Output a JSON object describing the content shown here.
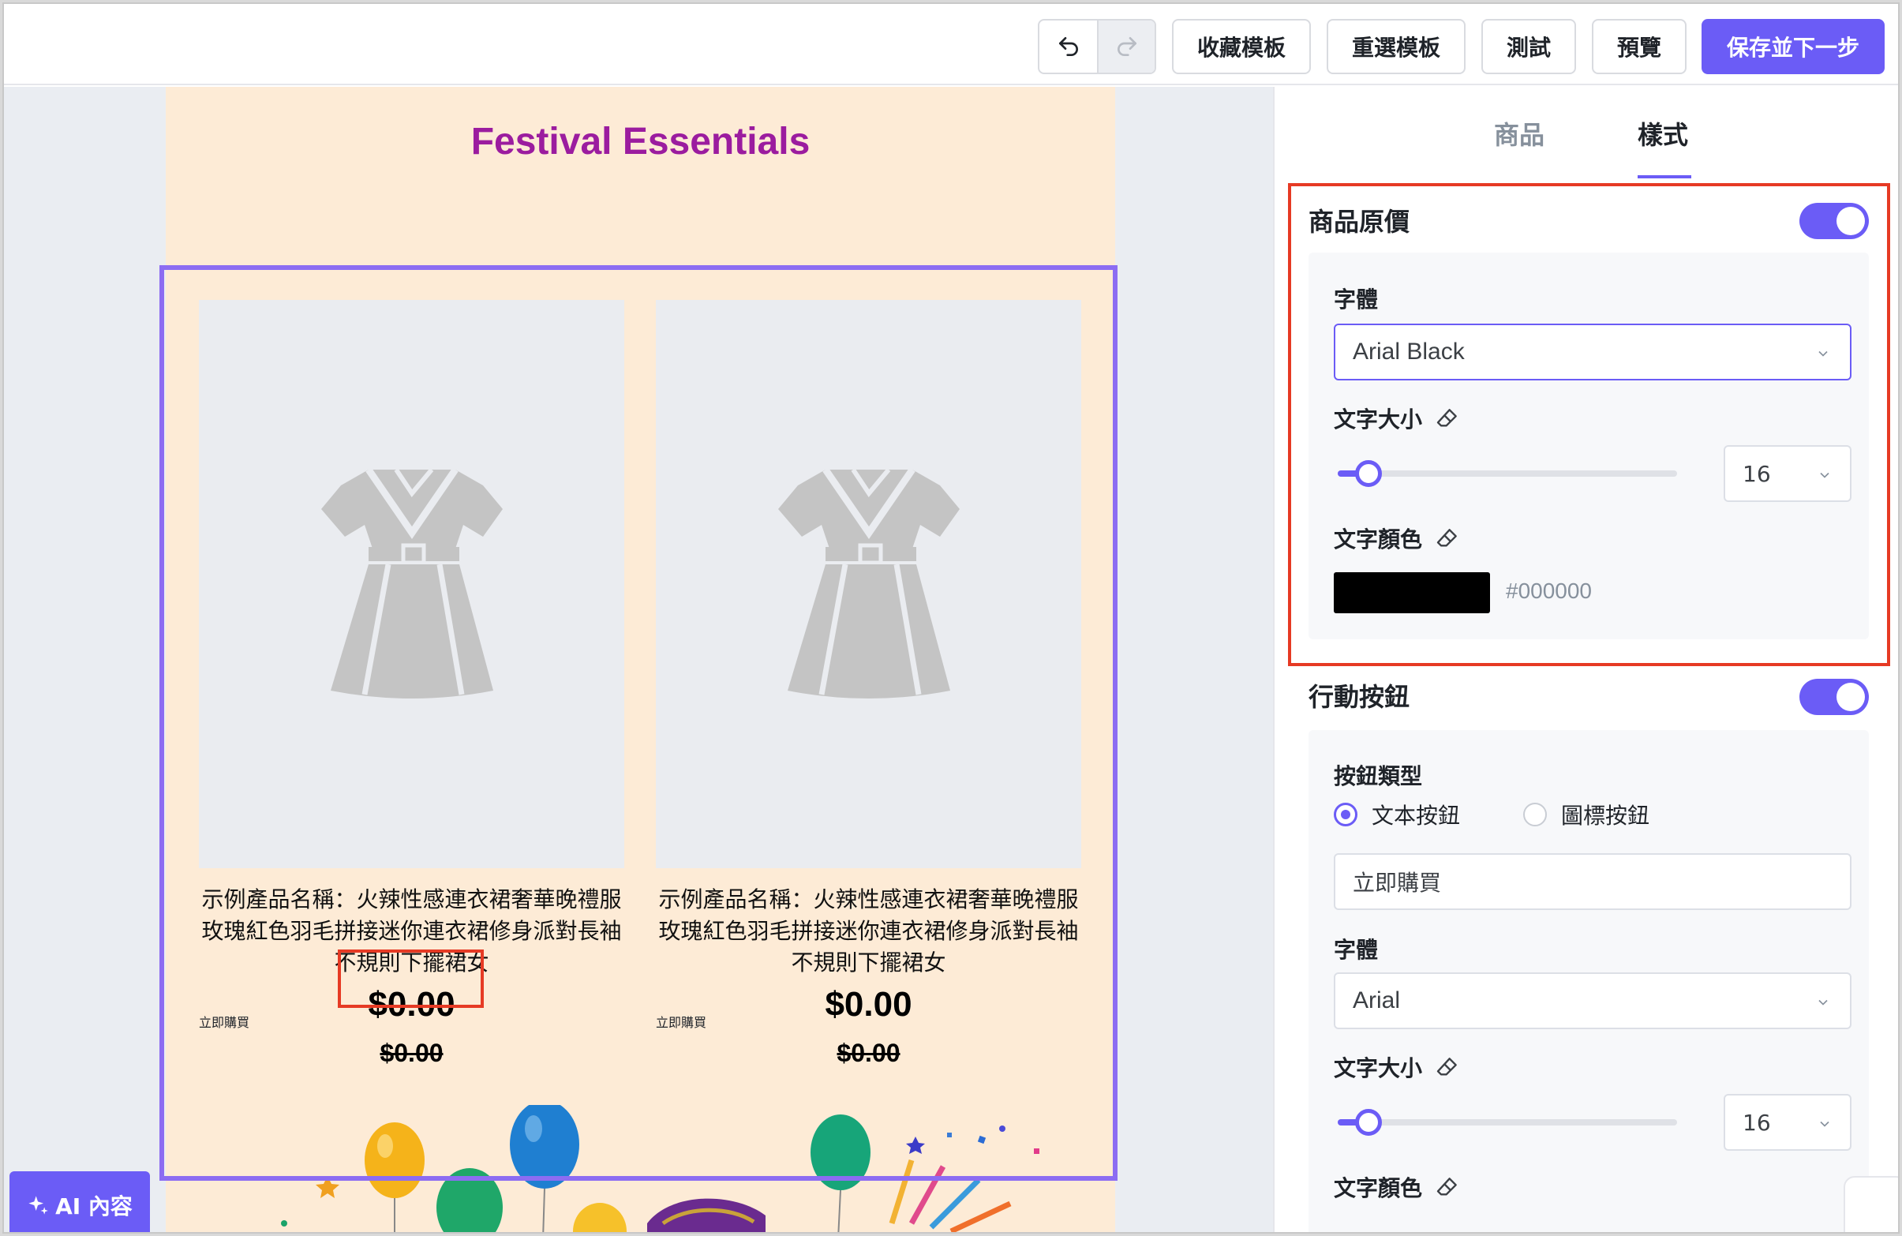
{
  "toolbar": {
    "undo_icon": "undo-icon",
    "redo_icon": "redo-icon",
    "favorite_template": "收藏模板",
    "reselect_template": "重選模板",
    "test": "測試",
    "preview": "預覽",
    "save_next": "保存並下一步"
  },
  "email": {
    "title": "Festival Essentials",
    "title_color": "#9b1c9f",
    "background": "#fdebd6",
    "products": [
      {
        "name": "示例產品名稱：火辣性感連衣裙奢華晚禮服玫瑰紅色羽毛拼接迷你連衣裙修身派對長袖不規則下擺裙女",
        "price": "$0.00",
        "original_price": "$0.00",
        "button": "立即購買"
      },
      {
        "name": "示例產品名稱：火辣性感連衣裙奢華晚禮服玫瑰紅色羽毛拼接迷你連衣裙修身派對長袖不規則下擺裙女",
        "price": "$0.00",
        "original_price": "$0.00",
        "button": "立即購買"
      }
    ]
  },
  "ai_button": {
    "label": "AI 內容",
    "icon": "sparkle-icon"
  },
  "panel": {
    "tabs": [
      {
        "label": "商品",
        "active": false
      },
      {
        "label": "樣式",
        "active": true
      }
    ],
    "original_price": {
      "title": "商品原價",
      "enabled": true,
      "font_label": "字體",
      "font_value": "Arial Black",
      "size_label": "文字大小",
      "size_value": "16",
      "color_label": "文字顏色",
      "color_value": "#000000"
    },
    "action_button": {
      "title": "行動按鈕",
      "enabled": true,
      "type_label": "按鈕類型",
      "type_text": "文本按鈕",
      "type_icon": "圖標按鈕",
      "selected_type": "文本按鈕",
      "text_value": "立即購買",
      "font_label": "字體",
      "font_value": "Arial",
      "size_label": "文字大小",
      "size_value": "16",
      "color_label": "文字顏色"
    }
  },
  "colors": {
    "accent": "#6b5cf6",
    "highlight": "#e63a24",
    "selection": "#8c6cf2"
  }
}
